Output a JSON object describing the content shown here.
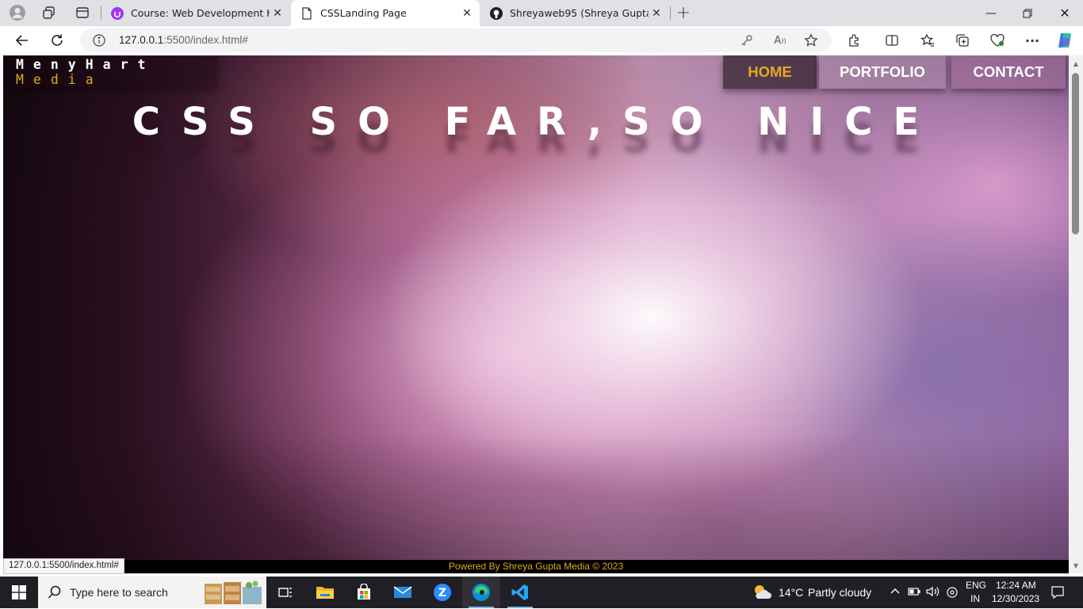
{
  "browser": {
    "tabs": [
      {
        "title": "Course: Web Development HTML",
        "active": false
      },
      {
        "title": "CSSLanding Page",
        "active": true
      },
      {
        "title": "Shreyaweb95 (Shreya Gupta)",
        "active": false
      }
    ],
    "address": {
      "host": "127.0.0.1",
      "rest": ":5500/index.html#"
    }
  },
  "page": {
    "logo_line1": "MenyHart",
    "logo_line2": "Media",
    "nav": [
      "HOME",
      "PORTFOLIO",
      "CONTACT"
    ],
    "hero_title": "CSS SO FAR,SO NICE",
    "footer_text": "Powered By Shreya Gupta Media © 2023",
    "status_url": "127.0.0.1:5500/index.html#",
    "accent_color": "#e0a81e"
  },
  "taskbar": {
    "search_placeholder": "Type here to search",
    "weather_temp": "14°C",
    "weather_desc": "Partly cloudy",
    "lang_1": "ENG",
    "lang_2": "IN",
    "time": "12:24 AM",
    "date": "12/30/2023",
    "apps": [
      "task-view-icon",
      "file-explorer-icon",
      "store-icon",
      "mail-icon",
      "zoom-icon",
      "edge-icon",
      "vscode-icon"
    ]
  }
}
